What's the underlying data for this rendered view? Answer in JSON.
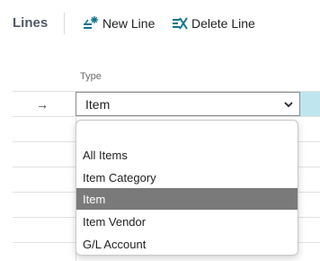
{
  "toolbar": {
    "title": "Lines",
    "new_line_label": "New Line",
    "delete_line_label": "Delete Line"
  },
  "grid": {
    "column_header": "Type",
    "current_row_indicator": "→"
  },
  "type_field": {
    "value": "Item"
  },
  "dropdown": {
    "options": [
      {
        "label": ""
      },
      {
        "label": "All Items"
      },
      {
        "label": "Item Category"
      },
      {
        "label": "Item",
        "selected": true
      },
      {
        "label": "Item Vendor"
      },
      {
        "label": "G/L Account"
      }
    ]
  },
  "colors": {
    "accent": "#0e7490",
    "selected_bg": "#7a7a7a",
    "row_highlight": "#bfe6ef"
  },
  "icons": {
    "new_line": "new-line-icon",
    "delete_line": "delete-line-icon",
    "chevron": "chevron-down-icon",
    "arrow": "row-arrow-icon"
  }
}
